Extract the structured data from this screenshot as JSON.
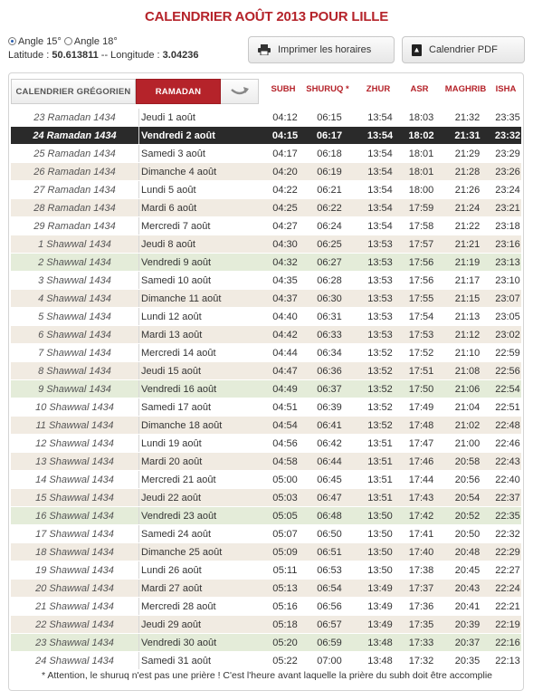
{
  "page": {
    "title": "CALENDRIER AOÛT 2013 POUR LILLE"
  },
  "options": {
    "angle1_label": "Angle 15°",
    "angle2_label": "Angle 18°",
    "latitude_label": "Latitude :",
    "latitude_value": "50.613811",
    "separator": "--",
    "longitude_label": "Longitude :",
    "longitude_value": "3.04236"
  },
  "buttons": {
    "print_label": "Imprimer les horaires",
    "pdf_label": "Calendrier PDF"
  },
  "tabs": {
    "gregorian_label": "CALENDRIER GRÉGORIEN",
    "ramadan_label": "RAMADAN"
  },
  "headers": [
    "SUBH",
    "SHURUQ *",
    "ZHUR",
    "ASR",
    "MAGHRIB",
    "ISHA"
  ],
  "rows": [
    {
      "hijri": "23 Ramadan 1434",
      "date": "Jeudi 1 août",
      "times": [
        "04:12",
        "06:15",
        "13:54",
        "18:03",
        "21:32",
        "23:35"
      ],
      "style": "odd"
    },
    {
      "hijri": "24 Ramadan 1434",
      "date": "Vendredi 2 août",
      "times": [
        "04:15",
        "06:17",
        "13:54",
        "18:02",
        "21:31",
        "23:32"
      ],
      "style": "sel"
    },
    {
      "hijri": "25 Ramadan 1434",
      "date": "Samedi 3 août",
      "times": [
        "04:17",
        "06:18",
        "13:54",
        "18:01",
        "21:29",
        "23:29"
      ],
      "style": "odd"
    },
    {
      "hijri": "26 Ramadan 1434",
      "date": "Dimanche 4 août",
      "times": [
        "04:20",
        "06:19",
        "13:54",
        "18:01",
        "21:28",
        "23:26"
      ],
      "style": "even"
    },
    {
      "hijri": "27 Ramadan 1434",
      "date": "Lundi 5 août",
      "times": [
        "04:22",
        "06:21",
        "13:54",
        "18:00",
        "21:26",
        "23:24"
      ],
      "style": "odd"
    },
    {
      "hijri": "28 Ramadan 1434",
      "date": "Mardi 6 août",
      "times": [
        "04:25",
        "06:22",
        "13:54",
        "17:59",
        "21:24",
        "23:21"
      ],
      "style": "even"
    },
    {
      "hijri": "29 Ramadan 1434",
      "date": "Mercredi 7 août",
      "times": [
        "04:27",
        "06:24",
        "13:54",
        "17:58",
        "21:22",
        "23:18"
      ],
      "style": "odd"
    },
    {
      "hijri": "1 Shawwal 1434",
      "date": "Jeudi 8 août",
      "times": [
        "04:30",
        "06:25",
        "13:53",
        "17:57",
        "21:21",
        "23:16"
      ],
      "style": "even"
    },
    {
      "hijri": "2 Shawwal 1434",
      "date": "Vendredi 9 août",
      "times": [
        "04:32",
        "06:27",
        "13:53",
        "17:56",
        "21:19",
        "23:13"
      ],
      "style": "green"
    },
    {
      "hijri": "3 Shawwal 1434",
      "date": "Samedi 10 août",
      "times": [
        "04:35",
        "06:28",
        "13:53",
        "17:56",
        "21:17",
        "23:10"
      ],
      "style": "odd"
    },
    {
      "hijri": "4 Shawwal 1434",
      "date": "Dimanche 11 août",
      "times": [
        "04:37",
        "06:30",
        "13:53",
        "17:55",
        "21:15",
        "23:07"
      ],
      "style": "even"
    },
    {
      "hijri": "5 Shawwal 1434",
      "date": "Lundi 12 août",
      "times": [
        "04:40",
        "06:31",
        "13:53",
        "17:54",
        "21:13",
        "23:05"
      ],
      "style": "odd"
    },
    {
      "hijri": "6 Shawwal 1434",
      "date": "Mardi 13 août",
      "times": [
        "04:42",
        "06:33",
        "13:53",
        "17:53",
        "21:12",
        "23:02"
      ],
      "style": "even"
    },
    {
      "hijri": "7 Shawwal 1434",
      "date": "Mercredi 14 août",
      "times": [
        "04:44",
        "06:34",
        "13:52",
        "17:52",
        "21:10",
        "22:59"
      ],
      "style": "odd"
    },
    {
      "hijri": "8 Shawwal 1434",
      "date": "Jeudi 15 août",
      "times": [
        "04:47",
        "06:36",
        "13:52",
        "17:51",
        "21:08",
        "22:56"
      ],
      "style": "even"
    },
    {
      "hijri": "9 Shawwal 1434",
      "date": "Vendredi 16 août",
      "times": [
        "04:49",
        "06:37",
        "13:52",
        "17:50",
        "21:06",
        "22:54"
      ],
      "style": "green"
    },
    {
      "hijri": "10 Shawwal 1434",
      "date": "Samedi 17 août",
      "times": [
        "04:51",
        "06:39",
        "13:52",
        "17:49",
        "21:04",
        "22:51"
      ],
      "style": "odd"
    },
    {
      "hijri": "11 Shawwal 1434",
      "date": "Dimanche 18 août",
      "times": [
        "04:54",
        "06:41",
        "13:52",
        "17:48",
        "21:02",
        "22:48"
      ],
      "style": "even"
    },
    {
      "hijri": "12 Shawwal 1434",
      "date": "Lundi 19 août",
      "times": [
        "04:56",
        "06:42",
        "13:51",
        "17:47",
        "21:00",
        "22:46"
      ],
      "style": "odd"
    },
    {
      "hijri": "13 Shawwal 1434",
      "date": "Mardi 20 août",
      "times": [
        "04:58",
        "06:44",
        "13:51",
        "17:46",
        "20:58",
        "22:43"
      ],
      "style": "even"
    },
    {
      "hijri": "14 Shawwal 1434",
      "date": "Mercredi 21 août",
      "times": [
        "05:00",
        "06:45",
        "13:51",
        "17:44",
        "20:56",
        "22:40"
      ],
      "style": "odd"
    },
    {
      "hijri": "15 Shawwal 1434",
      "date": "Jeudi 22 août",
      "times": [
        "05:03",
        "06:47",
        "13:51",
        "17:43",
        "20:54",
        "22:37"
      ],
      "style": "even"
    },
    {
      "hijri": "16 Shawwal 1434",
      "date": "Vendredi 23 août",
      "times": [
        "05:05",
        "06:48",
        "13:50",
        "17:42",
        "20:52",
        "22:35"
      ],
      "style": "green"
    },
    {
      "hijri": "17 Shawwal 1434",
      "date": "Samedi 24 août",
      "times": [
        "05:07",
        "06:50",
        "13:50",
        "17:41",
        "20:50",
        "22:32"
      ],
      "style": "odd"
    },
    {
      "hijri": "18 Shawwal 1434",
      "date": "Dimanche 25 août",
      "times": [
        "05:09",
        "06:51",
        "13:50",
        "17:40",
        "20:48",
        "22:29"
      ],
      "style": "even"
    },
    {
      "hijri": "19 Shawwal 1434",
      "date": "Lundi 26 août",
      "times": [
        "05:11",
        "06:53",
        "13:50",
        "17:38",
        "20:45",
        "22:27"
      ],
      "style": "odd"
    },
    {
      "hijri": "20 Shawwal 1434",
      "date": "Mardi 27 août",
      "times": [
        "05:13",
        "06:54",
        "13:49",
        "17:37",
        "20:43",
        "22:24"
      ],
      "style": "even"
    },
    {
      "hijri": "21 Shawwal 1434",
      "date": "Mercredi 28 août",
      "times": [
        "05:16",
        "06:56",
        "13:49",
        "17:36",
        "20:41",
        "22:21"
      ],
      "style": "odd"
    },
    {
      "hijri": "22 Shawwal 1434",
      "date": "Jeudi 29 août",
      "times": [
        "05:18",
        "06:57",
        "13:49",
        "17:35",
        "20:39",
        "22:19"
      ],
      "style": "even"
    },
    {
      "hijri": "23 Shawwal 1434",
      "date": "Vendredi 30 août",
      "times": [
        "05:20",
        "06:59",
        "13:48",
        "17:33",
        "20:37",
        "22:16"
      ],
      "style": "green"
    },
    {
      "hijri": "24 Shawwal 1434",
      "date": "Samedi 31 août",
      "times": [
        "05:22",
        "07:00",
        "13:48",
        "17:32",
        "20:35",
        "22:13"
      ],
      "style": "odd"
    }
  ],
  "footnote": "* Attention, le shuruq n'est pas une prière ! C'est l'heure avant laquelle la prière du subh doit être accomplie",
  "colors": {
    "accent": "#b5232a",
    "selected_row": "#2a2a2a",
    "alt_row": "#f1ebe2",
    "friday_row": "#e4ecd9"
  },
  "icons": [
    "radio-icon",
    "printer-icon",
    "pdf-icon",
    "refresh-arrow-icon"
  ]
}
